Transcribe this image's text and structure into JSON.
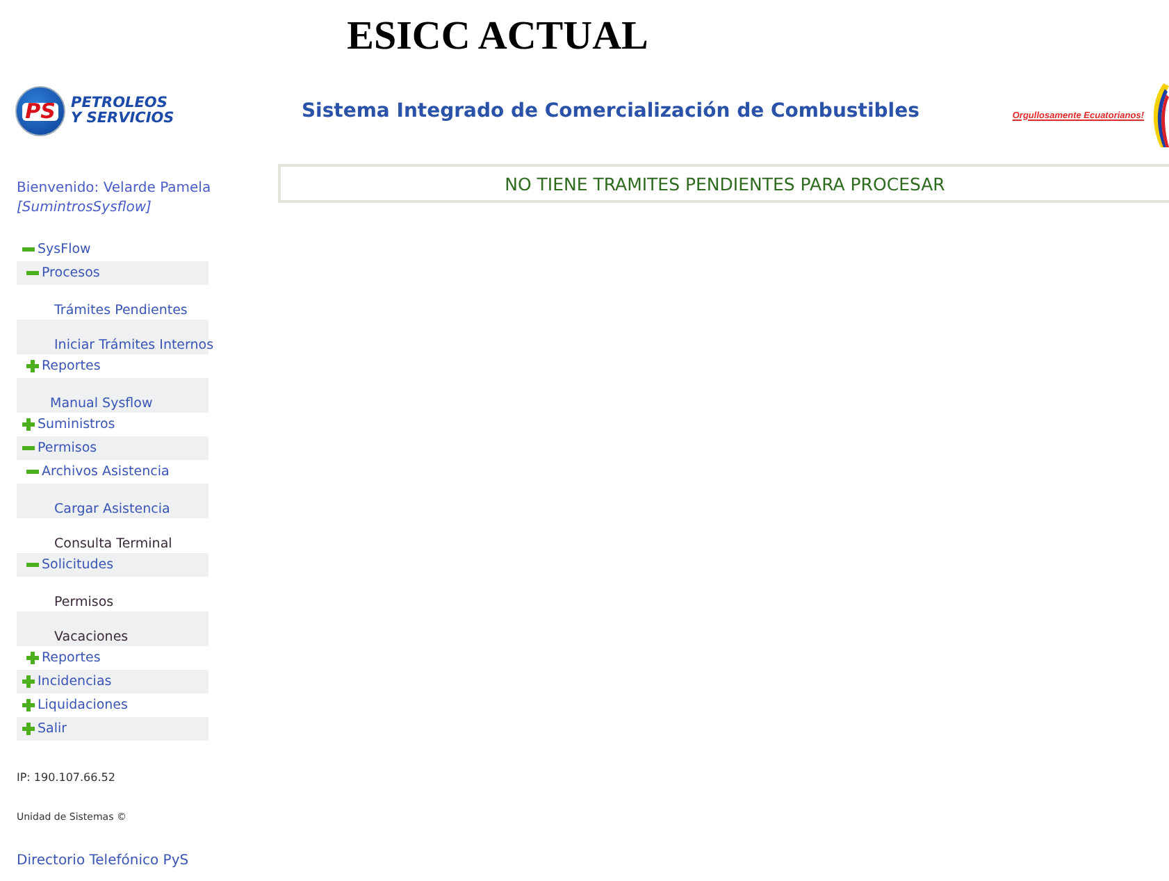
{
  "document_title": "ESICC ACTUAL",
  "header": {
    "logo": {
      "mark": "PS",
      "lines": [
        "PETROLEOS",
        "Y SERVICIOS"
      ]
    },
    "title": "Sistema Integrado de Comercialización de Combustibles",
    "slogan": "Orgullosamente Ecuatorianos!"
  },
  "sidebar": {
    "welcome": "Bienvenido: Velarde Pamela",
    "role": "[SumintrosSysflow]",
    "menu": [
      {
        "kind": "folder",
        "label": "SysFlow",
        "expanded": true,
        "children": [
          {
            "kind": "folder",
            "label": "Procesos",
            "expanded": true,
            "children": [
              {
                "kind": "link",
                "label": "Trámites Pendientes",
                "visited": false
              },
              {
                "kind": "link",
                "label": "Iniciar Trámites Internos",
                "visited": false
              }
            ]
          },
          {
            "kind": "folder",
            "label": "Reportes",
            "expanded": false
          },
          {
            "kind": "link",
            "label": "Manual Sysflow",
            "visited": false
          }
        ]
      },
      {
        "kind": "folder",
        "label": "Suministros",
        "expanded": false
      },
      {
        "kind": "folder",
        "label": "Permisos",
        "expanded": true,
        "children": [
          {
            "kind": "folder",
            "label": "Archivos Asistencia",
            "expanded": true,
            "children": [
              {
                "kind": "link",
                "label": "Cargar Asistencia",
                "visited": false
              },
              {
                "kind": "link",
                "label": "Consulta Terminal",
                "visited": true
              }
            ]
          },
          {
            "kind": "folder",
            "label": "Solicitudes",
            "expanded": true,
            "children": [
              {
                "kind": "link",
                "label": "Permisos",
                "visited": true
              },
              {
                "kind": "link",
                "label": "Vacaciones",
                "visited": true
              }
            ]
          },
          {
            "kind": "folder",
            "label": "Reportes",
            "expanded": false
          }
        ]
      },
      {
        "kind": "folder",
        "label": "Incidencias",
        "expanded": false
      },
      {
        "kind": "folder",
        "label": "Liquidaciones",
        "expanded": false
      },
      {
        "kind": "folder",
        "label": "Salir",
        "expanded": false
      }
    ],
    "ip": "IP: 190.107.66.52",
    "footer": "Unidad de Sistemas ©",
    "directory_link": "Directorio Telefónico PyS"
  },
  "message": "NO TIENE TRAMITES PENDIENTES PARA PROCESAR"
}
